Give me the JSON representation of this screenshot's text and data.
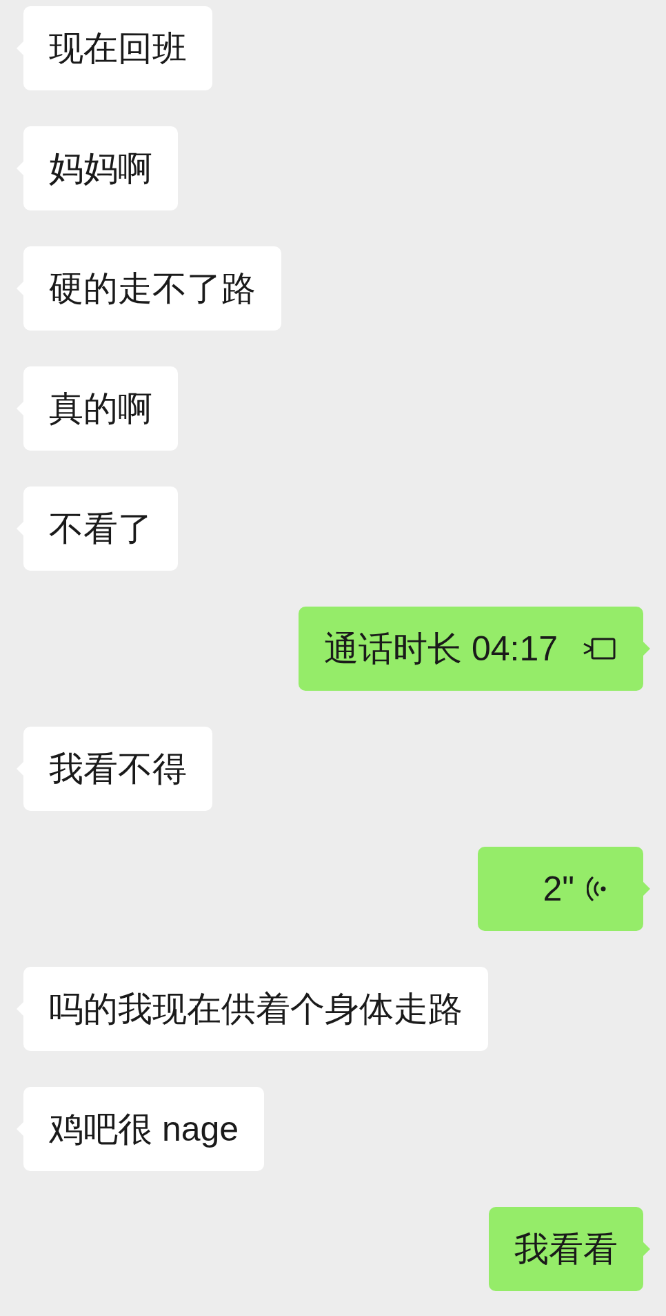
{
  "messages": [
    {
      "outgoing": false,
      "kind": "text",
      "text": "现在回班"
    },
    {
      "outgoing": false,
      "kind": "text",
      "text": "妈妈啊"
    },
    {
      "outgoing": false,
      "kind": "text",
      "text": "硬的走不了路"
    },
    {
      "outgoing": false,
      "kind": "text",
      "text": "真的啊"
    },
    {
      "outgoing": false,
      "kind": "text",
      "text": "不看了"
    },
    {
      "outgoing": true,
      "kind": "call",
      "text": "通话时长 04:17"
    },
    {
      "outgoing": false,
      "kind": "text",
      "text": "我看不得"
    },
    {
      "outgoing": true,
      "kind": "voice",
      "text": "2\""
    },
    {
      "outgoing": false,
      "kind": "text",
      "text": "吗的我现在供着个身体走路"
    },
    {
      "outgoing": false,
      "kind": "text",
      "text": "鸡吧很 nage"
    },
    {
      "outgoing": true,
      "kind": "text",
      "text": "我看看"
    }
  ]
}
